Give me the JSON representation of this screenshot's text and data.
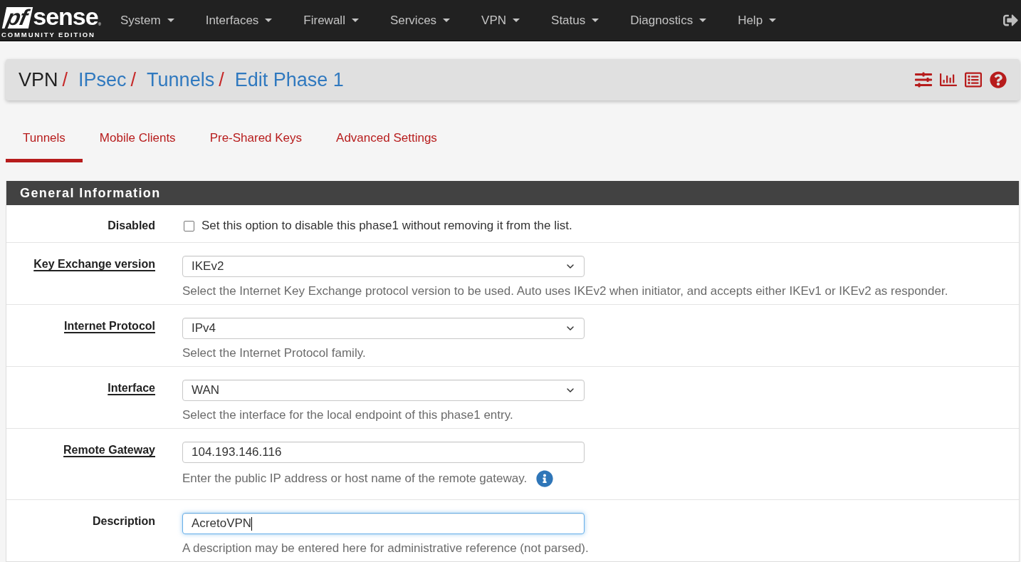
{
  "navbar": {
    "brand": {
      "logo_mark": "pf",
      "logo_name": "sense",
      "trademark": "®",
      "edition": "COMMUNITY EDITION"
    },
    "menu": [
      "System",
      "Interfaces",
      "Firewall",
      "Services",
      "VPN",
      "Status",
      "Diagnostics",
      "Help"
    ]
  },
  "breadcrumb": [
    {
      "label": "VPN",
      "link": false,
      "separator": "/"
    },
    {
      "label": "IPsec",
      "link": true,
      "separator": "/"
    },
    {
      "label": "Tunnels",
      "link": true,
      "separator": "/"
    },
    {
      "label": "Edit Phase 1",
      "link": true
    }
  ],
  "tabs": [
    {
      "label": "Tunnels",
      "selected": true
    },
    {
      "label": "Mobile Clients",
      "selected": false
    },
    {
      "label": "Pre-Shared Keys",
      "selected": false
    },
    {
      "label": "Advanced Settings",
      "selected": false
    }
  ],
  "panel": {
    "title": "General Information",
    "fields": [
      {
        "kind": "checkbox",
        "label": "Disabled",
        "help_link": false,
        "checked": false,
        "text": "Set this option to disable this phase1 without removing it from the list."
      },
      {
        "kind": "select",
        "label": "Key Exchange version",
        "help_link": true,
        "value": "IKEv2",
        "help": "Select the Internet Key Exchange protocol version to be used. Auto uses IKEv2 when initiator, and accepts either IKEv1 or IKEv2 as responder.",
        "info": false
      },
      {
        "kind": "select",
        "label": "Internet Protocol",
        "help_link": true,
        "value": "IPv4",
        "help": "Select the Internet Protocol family.",
        "info": false
      },
      {
        "kind": "select",
        "label": "Interface",
        "help_link": true,
        "value": "WAN",
        "help": "Select the interface for the local endpoint of this phase1 entry.",
        "info": false
      },
      {
        "kind": "text",
        "label": "Remote Gateway",
        "help_link": true,
        "value": "104.193.146.116",
        "help": "Enter the public IP address or host name of the remote gateway.",
        "info": true,
        "focused": false
      },
      {
        "kind": "text",
        "label": "Description",
        "help_link": false,
        "value": "AcretoVPN",
        "help": "A description may be entered here for administrative reference (not parsed).",
        "info": false,
        "focused": true
      }
    ]
  }
}
